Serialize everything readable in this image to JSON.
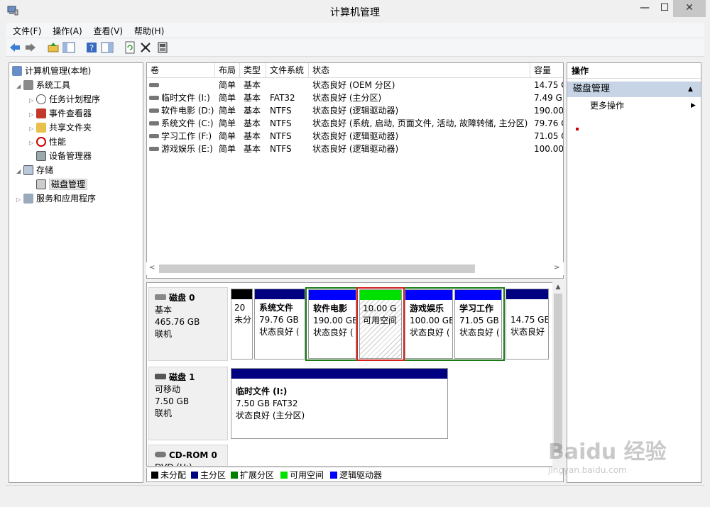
{
  "window": {
    "title": "计算机管理"
  },
  "menu": [
    "文件(F)",
    "操作(A)",
    "查看(V)",
    "帮助(H)"
  ],
  "tree": {
    "root": "计算机管理(本地)",
    "system_tools": "系统工具",
    "task_scheduler": "任务计划程序",
    "event_viewer": "事件查看器",
    "shared_folders": "共享文件夹",
    "performance": "性能",
    "device_manager": "设备管理器",
    "storage": "存储",
    "disk_management": "磁盘管理",
    "services_apps": "服务和应用程序"
  },
  "table": {
    "headers": [
      "卷",
      "布局",
      "类型",
      "文件系统",
      "状态",
      "容量"
    ],
    "rows": [
      {
        "vol": "",
        "layout": "简单",
        "type": "基本",
        "fs": "",
        "status": "状态良好 (OEM 分区)",
        "cap": "14.75 G"
      },
      {
        "vol": "临时文件 (I:)",
        "layout": "简单",
        "type": "基本",
        "fs": "FAT32",
        "status": "状态良好 (主分区)",
        "cap": "7.49 GE"
      },
      {
        "vol": "软件电影 (D:)",
        "layout": "简单",
        "type": "基本",
        "fs": "NTFS",
        "status": "状态良好 (逻辑驱动器)",
        "cap": "190.00"
      },
      {
        "vol": "系统文件 (C:)",
        "layout": "简单",
        "type": "基本",
        "fs": "NTFS",
        "status": "状态良好 (系统, 启动, 页面文件, 活动, 故障转储, 主分区)",
        "cap": "79.76 G"
      },
      {
        "vol": "学习工作 (F:)",
        "layout": "简单",
        "type": "基本",
        "fs": "NTFS",
        "status": "状态良好 (逻辑驱动器)",
        "cap": "71.05 G"
      },
      {
        "vol": "游戏娱乐 (E:)",
        "layout": "简单",
        "type": "基本",
        "fs": "NTFS",
        "status": "状态良好 (逻辑驱动器)",
        "cap": "100.00"
      }
    ]
  },
  "disks": {
    "disk0": {
      "name": "磁盘 0",
      "type": "基本",
      "size": "465.76 GB",
      "state": "联机"
    },
    "disk1": {
      "name": "磁盘 1",
      "type": "可移动",
      "size": "7.50 GB",
      "state": "联机"
    },
    "cdrom": {
      "name": "CD-ROM 0",
      "type": "DVD (H:)"
    }
  },
  "partitions": {
    "p0": {
      "size": "20",
      "status": "未分"
    },
    "c": {
      "name": "系统文件",
      "size": "79.76 GB",
      "status": "状态良好 ("
    },
    "d": {
      "name": "软件电影",
      "size": "190.00 GB",
      "status": "状态良好 ("
    },
    "free": {
      "size": "10.00 G",
      "status": "可用空间"
    },
    "e": {
      "name": "游戏娱乐",
      "size": "100.00 GB",
      "status": "状态良好 ("
    },
    "f": {
      "name": "学习工作",
      "size": "71.05 GB",
      "status": "状态良好 ("
    },
    "oem": {
      "size": "14.75 GE",
      "status": "状态良好"
    },
    "i": {
      "name": "临时文件  (I:)",
      "size": "7.50 GB FAT32",
      "status": "状态良好 (主分区)"
    }
  },
  "legend": [
    "未分配",
    "主分区",
    "扩展分区",
    "可用空间",
    "逻辑驱动器"
  ],
  "colors": {
    "unallocated": "#000000",
    "primary": "#000080",
    "extended": "#008000",
    "free": "#00e000",
    "logical": "#0000ff"
  },
  "actions": {
    "header": "操作",
    "section": "磁盘管理",
    "more": "更多操作"
  },
  "watermark": {
    "brand": "Baidu 经验",
    "url": "jingyan.baidu.com"
  }
}
